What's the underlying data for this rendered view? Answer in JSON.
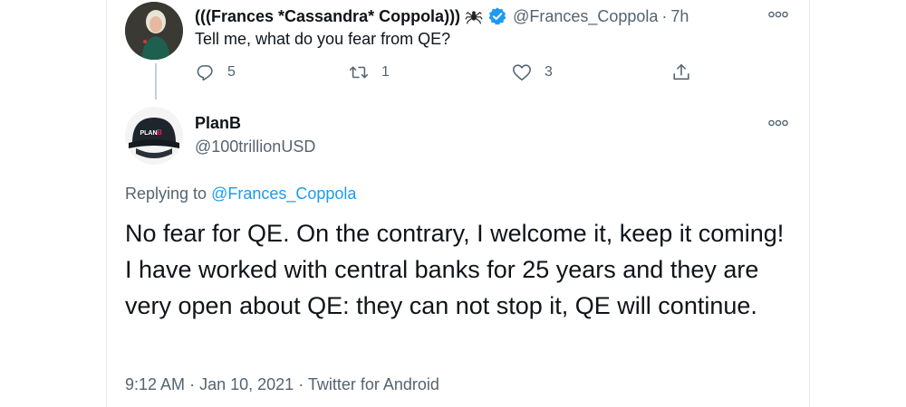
{
  "parent_tweet": {
    "display_name": "(((Frances *Cassandra* Coppola)))",
    "handle": "@Frances_Coppola",
    "separator": "·",
    "time": "7h",
    "text": "Tell me, what do you fear from QE?",
    "reply_count": "5",
    "retweet_count": "1",
    "like_count": "3"
  },
  "main_tweet": {
    "display_name": "PlanB",
    "handle": "@100trillionUSD",
    "avatar_text": "PLAN",
    "avatar_accent": "B",
    "replying_prefix": "Replying to",
    "replying_handle": "@Frances_Coppola",
    "text": "No fear for QE. On the contrary, I welcome it, keep it coming! I have worked with central banks for 25 years and they are very open about QE: they can not stop it, QE will continue.",
    "time": "9:12 AM",
    "date": "Jan 10, 2021",
    "source": "Twitter for Android",
    "separator": "·"
  },
  "colors": {
    "accent": "#1d9bf0",
    "secondary_text": "#536471",
    "primary_text": "#0f1419",
    "avatar_accent": "#e0245e"
  },
  "icons": [
    "spider-icon",
    "verified-icon",
    "more-icon",
    "reply-icon",
    "retweet-icon",
    "like-icon",
    "share-icon"
  ]
}
